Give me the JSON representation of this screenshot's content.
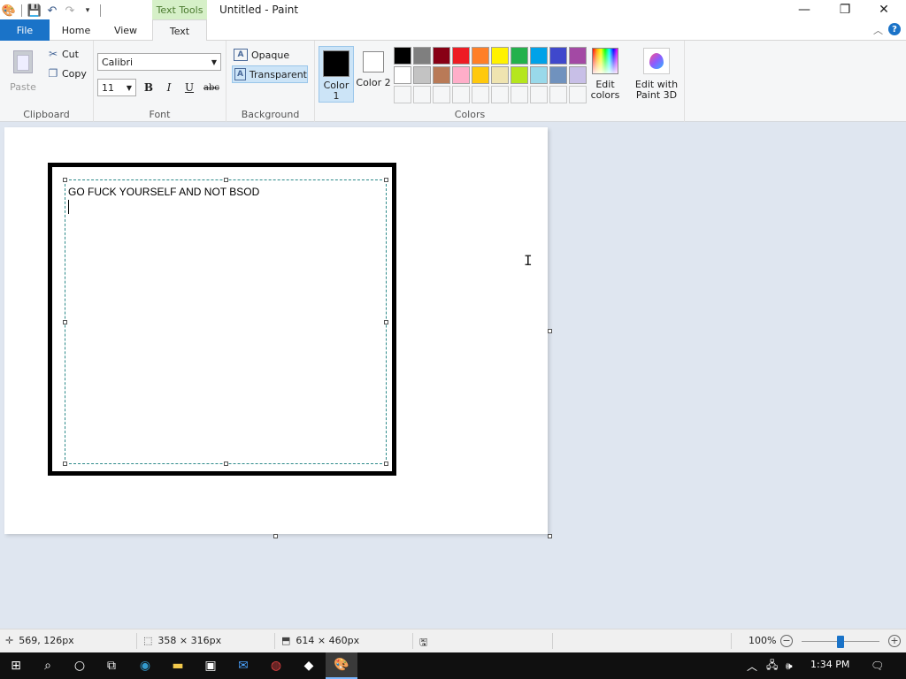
{
  "window": {
    "title": "Untitled - Paint",
    "context_tab": "Text Tools"
  },
  "tabs": [
    {
      "label": "File"
    },
    {
      "label": "Home"
    },
    {
      "label": "View"
    },
    {
      "label": "Text"
    }
  ],
  "ribbon": {
    "clipboard": {
      "group_label": "Clipboard",
      "paste": "Paste",
      "cut": "Cut",
      "copy": "Copy"
    },
    "font": {
      "group_label": "Font",
      "family": "Calibri",
      "size": "11",
      "bold": "B",
      "italic": "I",
      "underline": "U",
      "strike": "abc"
    },
    "background": {
      "group_label": "Background",
      "opaque": "Opaque",
      "transparent": "Transparent",
      "selected": "transparent"
    },
    "colors": {
      "group_label": "Colors",
      "color1_label": "Color 1",
      "color2_label": "Color 2",
      "color1": "#000000",
      "color2": "#ffffff",
      "palette_row1": [
        "#000000",
        "#7f7f7f",
        "#880015",
        "#ed1c24",
        "#ff7f27",
        "#fff200",
        "#22b14c",
        "#00a2e8",
        "#3f48cc",
        "#a349a4"
      ],
      "palette_row2": [
        "#ffffff",
        "#c3c3c3",
        "#b97a57",
        "#ffaec9",
        "#ffc90e",
        "#efe4b0",
        "#b5e61d",
        "#99d9ea",
        "#7092be",
        "#c8bfe7"
      ],
      "edit_colors": "Edit colors"
    },
    "paint3d": {
      "label": "Edit with Paint 3D"
    }
  },
  "canvas": {
    "text_content": "GO FUCK YOURSELF AND NOT BSOD"
  },
  "statusbar": {
    "cursor_pos": "569, 126px",
    "selection_size": "358 × 316px",
    "image_size": "614 × 460px",
    "zoom": "100%"
  },
  "taskbar": {
    "time": "1:34 PM"
  }
}
